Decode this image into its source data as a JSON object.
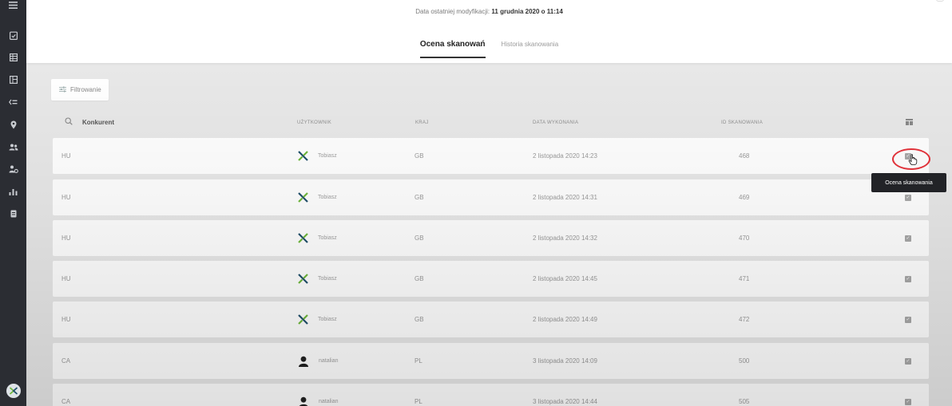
{
  "header": {
    "modified_label": "Data ostatniej modyfikacji:",
    "modified_date": "11 grudnia 2020 o 11:14",
    "tabs": [
      {
        "label": "Ocena skanowań"
      },
      {
        "label": "Historia skanowania"
      }
    ]
  },
  "toolbar": {
    "filter_label": "Filtrowanie"
  },
  "table": {
    "columns": {
      "competitor": "Konkurent",
      "user": "UŻYTKOWNIK",
      "country": "KRAJ",
      "date": "DATA WYKONANIA",
      "scan_id": "ID SKANOWANIA"
    },
    "rows": [
      {
        "competitor": "HU",
        "user": "Tobiasz",
        "user_icon": "logo-icon",
        "country": "GB",
        "date": "2 listopada 2020 14:23",
        "scan_id": "468"
      },
      {
        "competitor": "HU",
        "user": "Tobiasz",
        "user_icon": "logo-icon",
        "country": "GB",
        "date": "2 listopada 2020 14:31",
        "scan_id": "469"
      },
      {
        "competitor": "HU",
        "user": "Tobiasz",
        "user_icon": "logo-icon",
        "country": "GB",
        "date": "2 listopada 2020 14:32",
        "scan_id": "470"
      },
      {
        "competitor": "HU",
        "user": "Tobiasz",
        "user_icon": "logo-icon",
        "country": "GB",
        "date": "2 listopada 2020 14:45",
        "scan_id": "471"
      },
      {
        "competitor": "HU",
        "user": "Tobiasz",
        "user_icon": "logo-icon",
        "country": "GB",
        "date": "2 listopada 2020 14:49",
        "scan_id": "472"
      },
      {
        "competitor": "CA",
        "user": "natalian",
        "user_icon": "avatar-icon",
        "country": "PL",
        "date": "3 listopada 2020 14:09",
        "scan_id": "500"
      },
      {
        "competitor": "CA",
        "user": "natalian",
        "user_icon": "avatar-icon",
        "country": "PL",
        "date": "3 listopada 2020 14:44",
        "scan_id": "505"
      }
    ]
  },
  "tooltip": {
    "text": "Ocena skanowania"
  },
  "colors": {
    "sidebar": "#2b2d33",
    "highlight": "#e0323a",
    "tooltip_bg": "#222327",
    "logo_green": "#6fb83c",
    "logo_dark": "#1f4f6b"
  },
  "sidebar_icons": [
    "menu-icon",
    "clipboard-check-icon",
    "table-icon",
    "layout-icon",
    "compare-icon",
    "location-icon",
    "users-icon",
    "user-settings-icon",
    "chart-icon",
    "document-icon",
    "app-logo-icon"
  ]
}
